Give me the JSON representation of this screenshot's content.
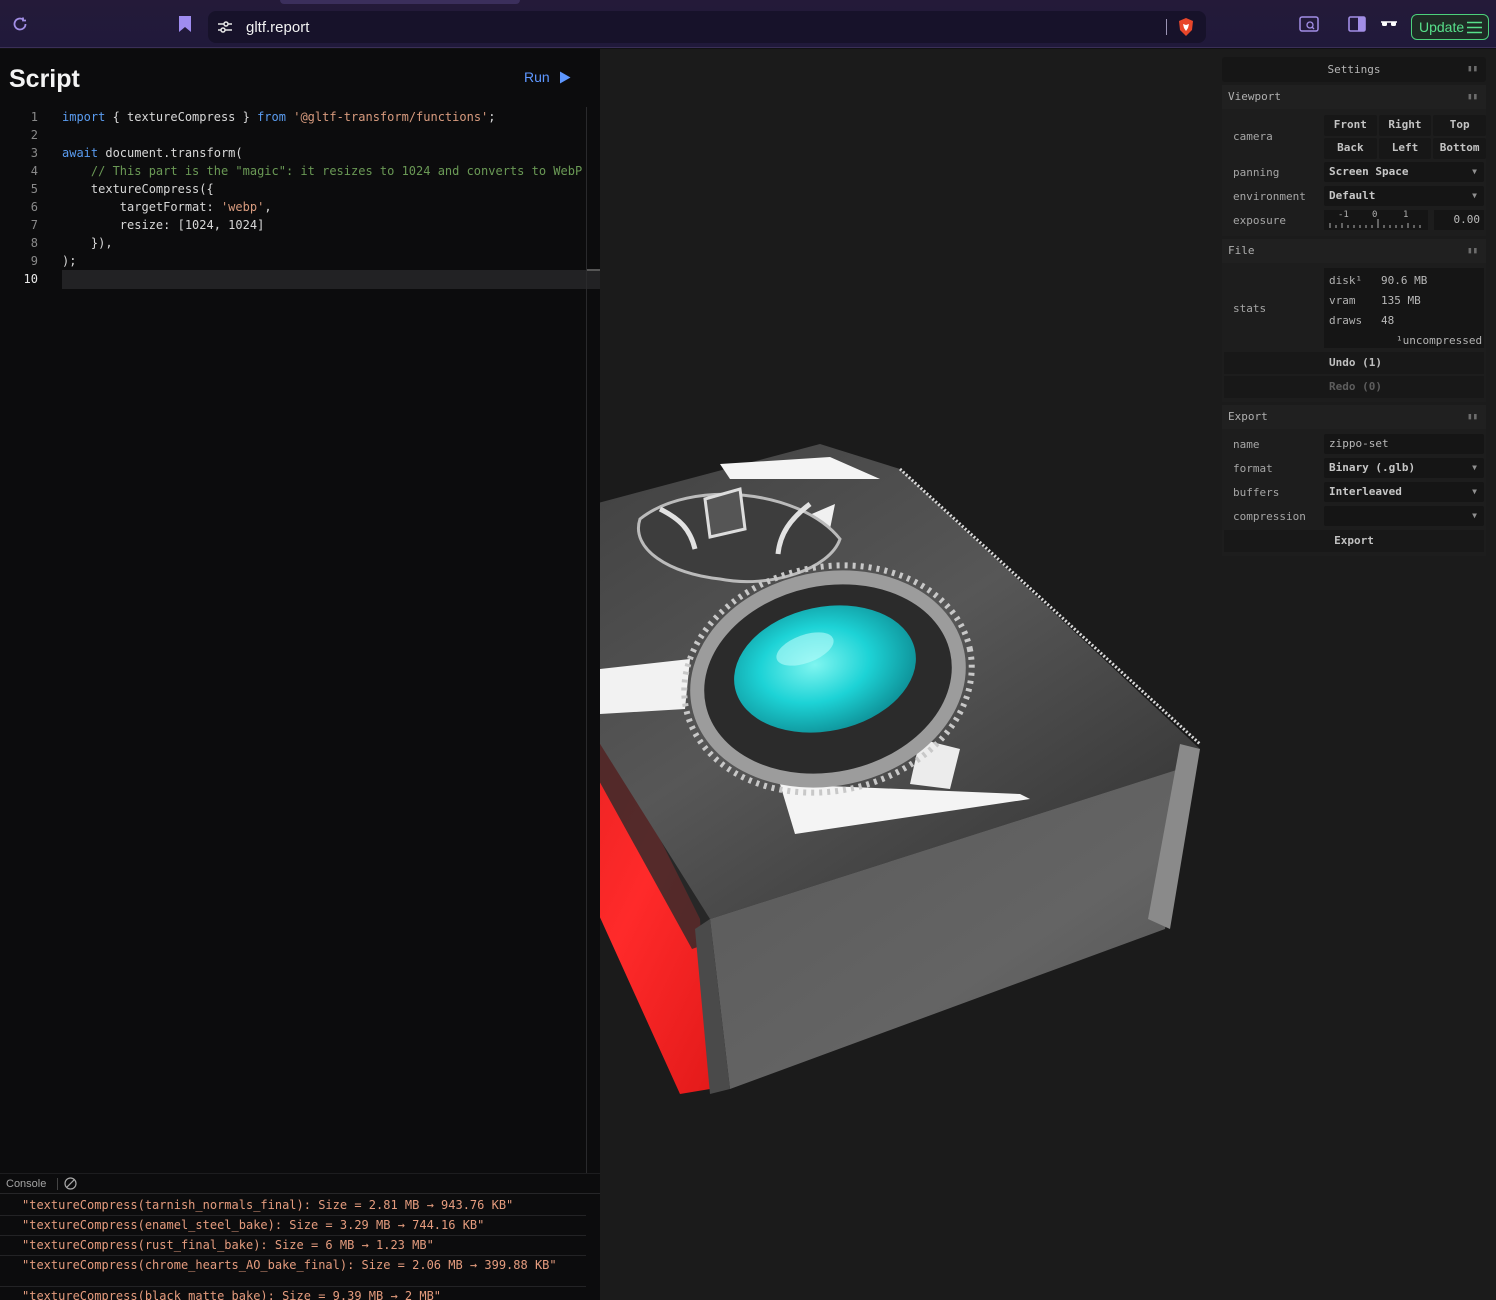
{
  "browser": {
    "url": "gltf.report",
    "update_label": "Update",
    "accent": "#a28ee6"
  },
  "script": {
    "title": "Script",
    "run_label": "Run",
    "line_numbers": [
      "1",
      "2",
      "3",
      "4",
      "5",
      "6",
      "7",
      "8",
      "9",
      "10"
    ],
    "lines": [
      [
        "import",
        " { textureCompress } ",
        "from",
        " ",
        "'@gltf-transform/functions'",
        ";"
      ],
      [],
      [
        "await",
        " document.transform("
      ],
      [
        "    ",
        "// This part is the \"magic\": it resizes to 1024 and converts to WebP"
      ],
      [
        "    textureCompress({"
      ],
      [
        "        targetFormat: ",
        "'webp'",
        ","
      ],
      [
        "        resize: [1024, 1024]"
      ],
      [
        "    }),"
      ],
      [
        ");"
      ],
      []
    ]
  },
  "console": {
    "label": "Console",
    "logs": [
      "\"textureCompress(tarnish_normals_final): Size = 2.81 MB → 943.76 KB\"",
      "\"textureCompress(enamel_steel_bake): Size = 3.29 MB → 744.16 KB\"",
      "\"textureCompress(rust_final_bake): Size = 6 MB → 1.23 MB\"",
      "\"textureCompress(chrome_hearts_AO_bake_final): Size = 2.06 MB → 399.88 KB\"",
      "\"textureCompress(black_matte_bake): Size = 9.39 MB → 2 MB\""
    ]
  },
  "settings": {
    "title": "Settings",
    "viewport": {
      "title": "Viewport",
      "camera_label": "camera",
      "camera_buttons": [
        "Front",
        "Right",
        "Top",
        "Back",
        "Left",
        "Bottom"
      ],
      "panning_label": "panning",
      "panning_value": "Screen Space",
      "environment_label": "environment",
      "environment_value": "Default",
      "exposure_label": "exposure",
      "exposure_ticks": [
        "-1",
        "0",
        "1"
      ],
      "exposure_value": "0.00"
    },
    "file": {
      "title": "File",
      "stats_label": "stats",
      "disk_label": "disk¹",
      "disk_value": "90.6 MB",
      "vram_label": "vram",
      "vram_value": "135 MB",
      "draws_label": "draws",
      "draws_value": "48",
      "footnote": "¹uncompressed",
      "undo_label": "Undo (1)",
      "redo_label": "Redo (0)"
    },
    "export": {
      "title": "Export",
      "name_label": "name",
      "name_value": "zippo-set",
      "format_label": "format",
      "format_value": "Binary (.glb)",
      "buffers_label": "buffers",
      "buffers_value": "Interleaved",
      "compression_label": "compression",
      "compression_value": "",
      "export_label": "Export"
    }
  }
}
